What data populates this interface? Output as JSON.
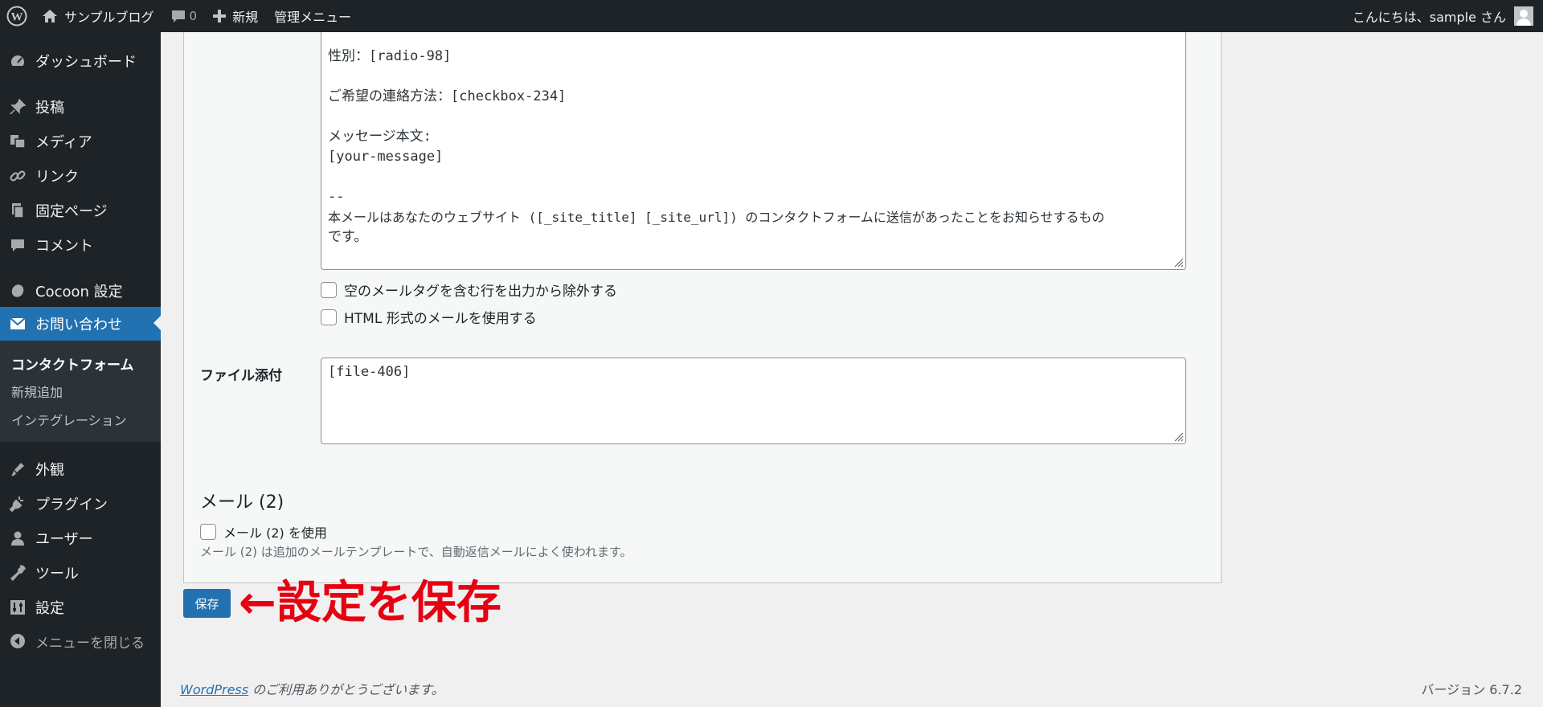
{
  "adminbar": {
    "site_name": "サンプルブログ",
    "comments_count": "0",
    "new_label": "新規",
    "admin_menu_label": "管理メニュー",
    "greeting": "こんにちは、sample さん"
  },
  "sidebar": {
    "dashboard": "ダッシュボード",
    "posts": "投稿",
    "media": "メディア",
    "links": "リンク",
    "pages": "固定ページ",
    "comments": "コメント",
    "cocoon": "Cocoon 設定",
    "contact": "お問い合わせ",
    "submenu": {
      "contact_forms": "コンタクトフォーム",
      "add_new": "新規追加",
      "integration": "インテグレーション"
    },
    "appearance": "外観",
    "plugins": "プラグイン",
    "users": "ユーザー",
    "tools": "ツール",
    "settings": "設定",
    "collapse": "メニューを閉じる"
  },
  "mail_body": {
    "line_gender": "性別：[radio-98]",
    "line_contact_method": "ご希望の連絡方法：[checkbox-234]",
    "line_message_label": "メッセージ本文:",
    "line_message_tag": "[your-message]",
    "line_separator": "--",
    "line_footer_1": "本メールはあなたのウェブサイト ([_site_title] [_site_url]) のコンタクトフォームに送信があったことをお知らせするもの",
    "line_footer_2": "です。"
  },
  "options": {
    "exclude_blank": "空のメールタグを含む行を出力から除外する",
    "use_html": "HTML 形式のメールを使用する"
  },
  "attachments": {
    "label": "ファイル添付",
    "value": "[file-406]"
  },
  "mail2": {
    "title": "メール (2)",
    "use_label": "メール (2) を使用",
    "description": "メール (2) は追加のメールテンプレートで、自動返信メールによく使われます。"
  },
  "save_label": "保存",
  "annotation": "←設定を保存",
  "footer": {
    "wp_link": "WordPress",
    "thanks": " のご利用ありがとうございます。",
    "version": "バージョン 6.7.2"
  },
  "colors": {
    "adminbar_bg": "#1d2327",
    "accent": "#2271b1",
    "annotation": "#e60012"
  },
  "icons": {
    "wp": "wordpress-logo-icon",
    "home": "home-icon",
    "comment": "comment-bubble-icon",
    "plus": "plus-icon"
  }
}
